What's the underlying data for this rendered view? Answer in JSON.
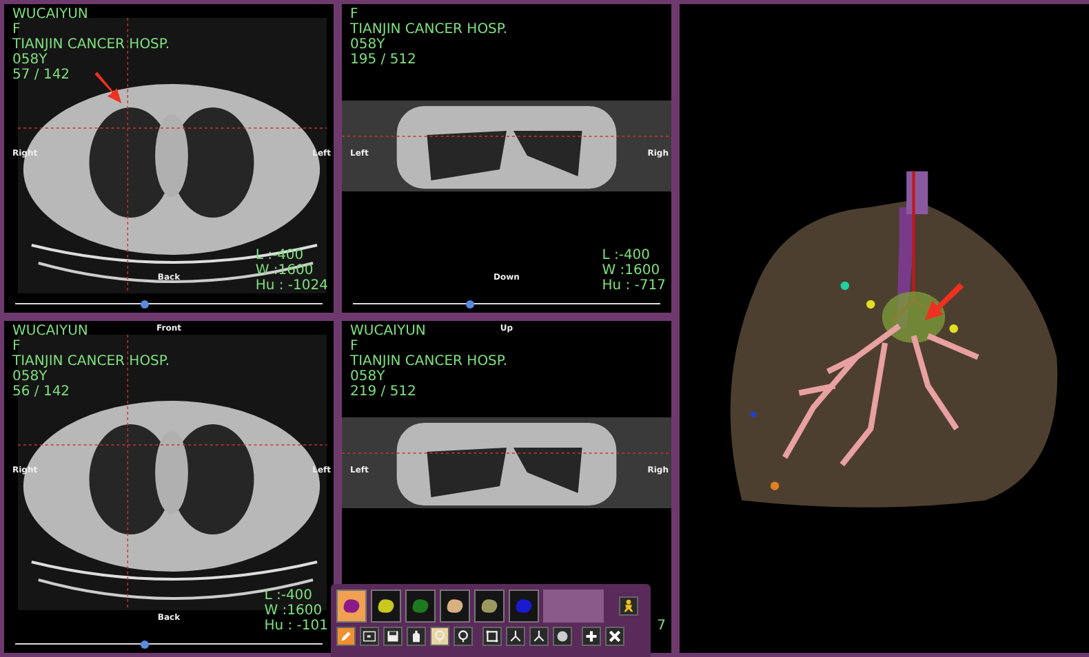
{
  "panels": [
    {
      "kind": "axial",
      "lines": [
        "WUCAIYUN",
        "F",
        "TIANJIN CANCER HOSP.",
        "058Y",
        "57 / 142"
      ],
      "left": "Right",
      "right": "Left",
      "bottom": "Back",
      "readings": [
        "L   :-400",
        "W :1600",
        "Hu : -1024"
      ],
      "arrow": true,
      "slider": {
        "level": 0.42
      }
    },
    {
      "kind": "coronal",
      "lines": [
        "F",
        "TIANJIN CANCER HOSP.",
        "058Y",
        "195 / 512"
      ],
      "left": "Left",
      "right": "Righ",
      "bottom": "Down",
      "readings": [
        "L   :-400",
        "W :1600",
        "Hu : -717"
      ],
      "slider": {
        "level": 0.38
      }
    },
    {
      "kind": "axial",
      "lines": [
        "WUCAIYUN",
        "F",
        "TIANJIN CANCER HOSP.",
        "058Y",
        "56 / 142"
      ],
      "top": "Front",
      "left": "Right",
      "right": "Left",
      "bottom": "Back",
      "readings": [
        "L   :-400",
        "W :1600",
        "Hu : -101"
      ],
      "slider": {
        "level": 0.42
      }
    },
    {
      "kind": "coronal",
      "lines": [
        "WUCAIYUN",
        "F",
        "TIANJIN CANCER HOSP.",
        "058Y",
        "219 / 512"
      ],
      "top": "Up",
      "left": "Left",
      "right": "Righ",
      "readings": [
        "7"
      ]
    }
  ],
  "toolbar": {
    "swatches": [
      {
        "color": "#8a1a8a",
        "selected": true
      },
      {
        "color": "#c8c81e",
        "selected": false
      },
      {
        "color": "#1e7a1e",
        "selected": false
      },
      {
        "color": "#d8b080",
        "selected": false
      },
      {
        "color": "#9a9a60",
        "selected": false
      },
      {
        "color": "#1a1ad0",
        "selected": false
      }
    ],
    "tools": [
      {
        "kind": "pencil",
        "selected": true,
        "toggled": false
      },
      {
        "kind": "screen",
        "selected": false,
        "toggled": false
      },
      {
        "kind": "save",
        "selected": false,
        "toggled": false
      },
      {
        "kind": "bottle",
        "selected": false,
        "toggled": false
      },
      {
        "kind": "pin",
        "selected": false,
        "toggled": true
      },
      {
        "kind": "pin",
        "selected": false,
        "toggled": false
      },
      {
        "kind": "frame",
        "selected": false,
        "toggled": false
      },
      {
        "kind": "branch",
        "selected": false,
        "toggled": false
      },
      {
        "kind": "branch",
        "selected": false,
        "toggled": false
      },
      {
        "kind": "sphere",
        "selected": false,
        "toggled": false
      },
      {
        "kind": "plus",
        "selected": false,
        "toggled": false
      },
      {
        "kind": "close",
        "selected": false,
        "toggled": false
      }
    ]
  }
}
